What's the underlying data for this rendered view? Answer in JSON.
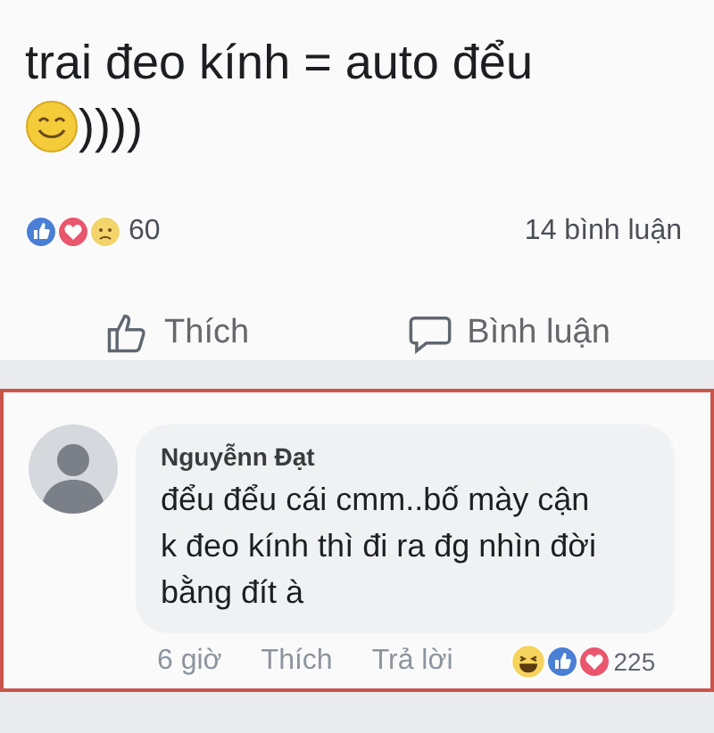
{
  "post": {
    "text": "trai đeo kính = auto đểu",
    "text_after_emoji": "))))",
    "reaction_count": "60",
    "comment_count": "14 bình luận",
    "actions": [
      {
        "kind": "like",
        "label": "Thích"
      },
      {
        "kind": "comment",
        "label": "Bình luận"
      }
    ]
  },
  "comment": {
    "author": "Nguyễnn Đạt",
    "lines": [
      "đểu đểu cái cmm..bố mày cận",
      "k đeo kính thì đi ra đg nhìn đời",
      "bằng đít à"
    ],
    "time": "6 giờ",
    "actions": [
      "Thích",
      "Trả lời"
    ],
    "reaction_count": "225"
  }
}
